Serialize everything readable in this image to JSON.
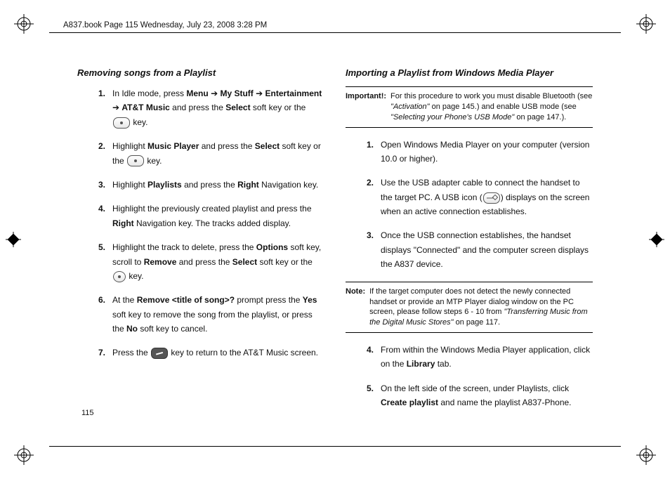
{
  "header": "A837.book  Page 115  Wednesday, July 23, 2008  3:28 PM",
  "page_number": "115",
  "left": {
    "heading": "Removing songs from a Playlist",
    "steps": [
      {
        "n": "1.",
        "pre": "In Idle mode, press ",
        "b1": "Menu",
        "arr1": " ➔ ",
        "b2": "My Stuff",
        "arr2": " ➔ ",
        "b3": "Entertainment",
        "arr3": " ➔ ",
        "b4": "AT&T Music",
        "mid": " and press the ",
        "b5": "Select",
        "post": " soft key or the ",
        "tail": " key."
      },
      {
        "n": "2.",
        "pre": "Highlight ",
        "b1": "Music Player",
        "mid": " and press the ",
        "b2": "Select",
        "post": " soft key or the ",
        "tail": " key."
      },
      {
        "n": "3.",
        "pre": "Highlight ",
        "b1": "Playlists",
        "mid": " and press the ",
        "b2": "Right",
        "post": " Navigation key."
      },
      {
        "n": "4.",
        "pre": "Highlight the previously created playlist and press the ",
        "b1": "Right",
        "post": " Navigation key. The tracks added display."
      },
      {
        "n": "5.",
        "pre": "Highlight the track to delete, press the ",
        "b1": "Options",
        "mid": " soft key, scroll to ",
        "b2": "Remove",
        "mid2": " and press the ",
        "b3": "Select",
        "post": " soft key or the ",
        "tail": " key."
      },
      {
        "n": "6.",
        "pre": "At the ",
        "b1": "Remove <title of song>?",
        "mid": " prompt press the ",
        "b2": "Yes",
        "mid2": " soft key to remove the song from the playlist, or press the ",
        "b3": "No",
        "post": " soft key to cancel."
      },
      {
        "n": "7.",
        "pre": "Press the ",
        "post": " key to return to the AT&T Music screen."
      }
    ]
  },
  "right": {
    "heading": "Importing a Playlist from Windows Media Player",
    "important": {
      "label": "Important!:",
      "t1": "For this procedure to work you must disable Bluetooth (see ",
      "r1": "\"Activation\"",
      "t2": " on page 145.) and enable USB mode (see ",
      "r2": "\"Selecting your Phone's USB Mode\"",
      "t3": " on page 147.)."
    },
    "stepsA": [
      {
        "n": "1.",
        "text": "Open Windows Media Player on your computer (version 10.0 or higher)."
      },
      {
        "n": "2.",
        "pre": "Use the USB adapter cable to connect the handset to the target PC. A USB icon (",
        "post": ") displays on the screen when an active connection establishes."
      },
      {
        "n": "3.",
        "text": "Once the USB connection establishes, the handset displays \"Connected\" and the computer screen displays the A837 device."
      }
    ],
    "note": {
      "label": "Note:",
      "t1": "If the target computer does not detect the newly connected handset or provide an MTP Player dialog window on the PC screen, please follow steps 6 - 10 from ",
      "r1": "\"Transferring Music from the Digital Music Stores\"",
      "t2": " on page 117."
    },
    "stepsB": [
      {
        "n": "4.",
        "pre": "From within the Windows Media Player application, click on the ",
        "b1": "Library",
        "post": " tab."
      },
      {
        "n": "5.",
        "pre": "On the left side of the screen, under Playlists, click ",
        "b1": "Create playlist",
        "post": " and name the playlist A837-Phone."
      }
    ]
  }
}
